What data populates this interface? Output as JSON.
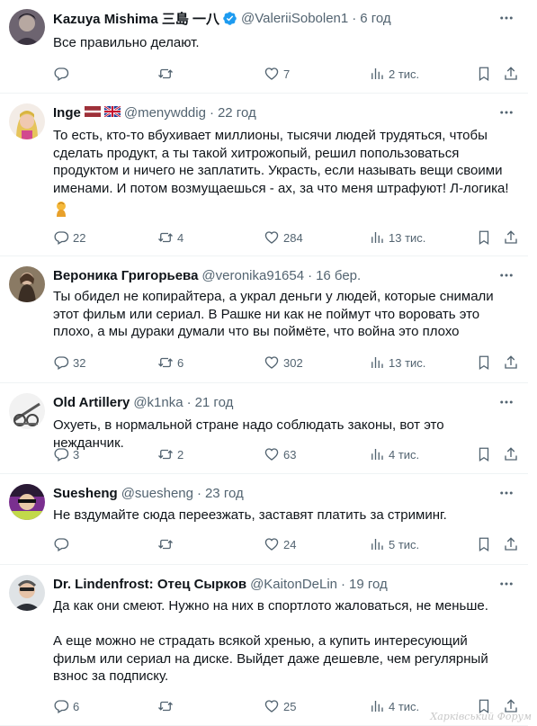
{
  "icons": {
    "reply": "reply-icon",
    "retweet": "retweet-icon",
    "like": "heart-icon",
    "views": "views-icon",
    "bookmark": "bookmark-icon",
    "share": "share-icon",
    "more": "more-icon"
  },
  "colors": {
    "muted": "#536471",
    "verified": "#1d9bf0",
    "divider": "#eff3f4"
  },
  "tweets": [
    {
      "name": "Kazuya Mishima 三島 一八",
      "verified": true,
      "handle": "@ValeriiSobolen1",
      "time": "6 год",
      "text": "Все правильно делают.",
      "replies": "",
      "retweets": "",
      "likes": "7",
      "views": "2 тис."
    },
    {
      "name": "Inge",
      "flags": "flags-latvia-uk",
      "handle": "@menywddig",
      "time": "22 год",
      "text": "То есть, кто-то вбухивает миллионы, тысячи людей трудяться, чтобы сделать продукт, а ты такой хитрожопый, решил попользоваться продуктом и ничего не заплатить. Украсть, если называть вещи своими именами. И потом возмущаешься - ах, за что меня штрафуют! Л-логика!",
      "emoji": "face-palm-emoji",
      "replies": "22",
      "retweets": "4",
      "likes": "284",
      "views": "13 тис."
    },
    {
      "name": "Вероника Григорьева",
      "handle": "@veronika91654",
      "time": "16 бер.",
      "text": "Ты обидел не копирайтера, а украл деньги у людей, которые снимали этот фильм или сериал. В Рашке ни как не поймут что воровать это плохо, а мы дураки думали что вы поймёте, что война это плохо",
      "replies": "32",
      "retweets": "6",
      "likes": "302",
      "views": "13 тис."
    },
    {
      "name": "Old Artillery",
      "handle": "@k1nka",
      "time": "21 год",
      "text": "Охуеть, в нормальной стране надо соблюдать законы, вот это нежданчик.",
      "replies": "3",
      "retweets": "2",
      "likes": "63",
      "views": "4 тис."
    },
    {
      "name": "Suesheng",
      "handle": "@suesheng",
      "time": "23 год",
      "text": "Не вздумайте сюда переезжать, заставят платить за стриминг.",
      "replies": "",
      "retweets": "",
      "likes": "24",
      "views": "5 тис."
    },
    {
      "name": "Dr. Lindenfrost: Отец Сырков",
      "handle": "@KaitonDeLin",
      "time": "19 год",
      "text": "Да как они смеют. Нужно на них в спортлото жаловаться, не меньше.\n\nА еще можно не страдать всякой хренью, а купить интересующий фильм или сериал на диске. Выйдет даже дешевле, чем регулярный взнос за подписку.",
      "replies": "6",
      "retweets": "",
      "likes": "25",
      "views": "4 тис."
    }
  ],
  "watermark": "Харківський Форум"
}
